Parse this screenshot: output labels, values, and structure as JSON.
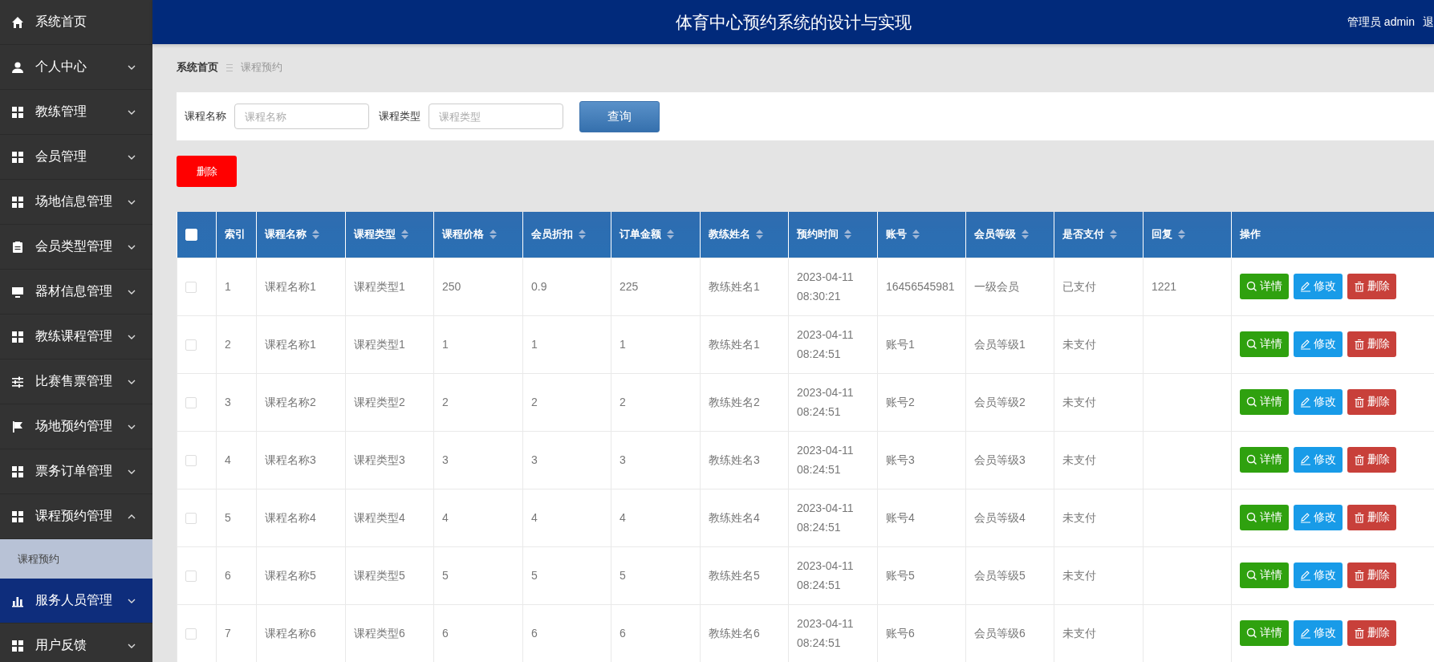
{
  "header": {
    "title": "体育中心预约系统的设计与实现",
    "user": "管理员 admin",
    "logout": "退"
  },
  "sidebar": {
    "items": [
      {
        "label": "系统首页",
        "kind": "link",
        "selected": false
      },
      {
        "label": "个人中心",
        "kind": "menu",
        "expanded": false,
        "selected": false
      },
      {
        "label": "教练管理",
        "kind": "menu",
        "expanded": false,
        "selected": false
      },
      {
        "label": "会员管理",
        "kind": "menu",
        "expanded": false,
        "selected": false
      },
      {
        "label": "场地信息管理",
        "kind": "menu",
        "expanded": false,
        "selected": false
      },
      {
        "label": "会员类型管理",
        "kind": "menu",
        "expanded": false,
        "selected": false
      },
      {
        "label": "器材信息管理",
        "kind": "menu",
        "expanded": false,
        "selected": false
      },
      {
        "label": "教练课程管理",
        "kind": "menu",
        "expanded": false,
        "selected": false
      },
      {
        "label": "比赛售票管理",
        "kind": "menu",
        "expanded": false,
        "selected": false
      },
      {
        "label": "场地预约管理",
        "kind": "menu",
        "expanded": false,
        "selected": false
      },
      {
        "label": "票务订单管理",
        "kind": "menu",
        "expanded": false,
        "selected": false
      },
      {
        "label": "课程预约管理",
        "kind": "menu",
        "expanded": true,
        "selected": false,
        "children": [
          {
            "label": "课程预约"
          }
        ]
      },
      {
        "label": "服务人员管理",
        "kind": "menu",
        "expanded": false,
        "selected": true
      },
      {
        "label": "用户反馈",
        "kind": "menu",
        "expanded": false,
        "selected": false
      }
    ]
  },
  "breadcrumb": [
    {
      "label": "系统首页",
      "current": false
    },
    {
      "label": "课程预约",
      "current": true
    }
  ],
  "search": {
    "fields": [
      {
        "label": "课程名称",
        "placeholder": "课程名称"
      },
      {
        "label": "课程类型",
        "placeholder": "课程类型"
      }
    ],
    "button": "查询"
  },
  "toolbar": {
    "delete_button": "删除"
  },
  "table": {
    "select_all_checked": false,
    "columns": [
      {
        "label": "索引",
        "sortable": false
      },
      {
        "label": "课程名称",
        "sortable": true
      },
      {
        "label": "课程类型",
        "sortable": true
      },
      {
        "label": "课程价格",
        "sortable": true
      },
      {
        "label": "会员折扣",
        "sortable": true
      },
      {
        "label": "订单金额",
        "sortable": true
      },
      {
        "label": "教练姓名",
        "sortable": true
      },
      {
        "label": "预约时间",
        "sortable": true
      },
      {
        "label": "账号",
        "sortable": true
      },
      {
        "label": "会员等级",
        "sortable": true
      },
      {
        "label": "是否支付",
        "sortable": true
      },
      {
        "label": "回复",
        "sortable": true
      },
      {
        "label": "操作",
        "sortable": false
      }
    ],
    "rows": [
      {
        "checked": false,
        "cells": [
          "1",
          "课程名称1",
          "课程类型1",
          "250",
          "0.9",
          "225",
          "教练姓名1",
          "2023-04-11 08:30:21",
          "16456545981",
          "一级会员",
          "已支付",
          "1221"
        ],
        "actions": [
          {
            "kind": "view",
            "label": "详情"
          },
          {
            "kind": "edit",
            "label": "修改"
          },
          {
            "kind": "delete",
            "label": "删除"
          }
        ]
      },
      {
        "checked": false,
        "cells": [
          "2",
          "课程名称1",
          "课程类型1",
          "1",
          "1",
          "1",
          "教练姓名1",
          "2023-04-11 08:24:51",
          "账号1",
          "会员等级1",
          "未支付",
          ""
        ],
        "actions": [
          {
            "kind": "view",
            "label": "详情"
          },
          {
            "kind": "edit",
            "label": "修改"
          },
          {
            "kind": "delete",
            "label": "删除"
          }
        ]
      },
      {
        "checked": false,
        "cells": [
          "3",
          "课程名称2",
          "课程类型2",
          "2",
          "2",
          "2",
          "教练姓名2",
          "2023-04-11 08:24:51",
          "账号2",
          "会员等级2",
          "未支付",
          ""
        ],
        "actions": [
          {
            "kind": "view",
            "label": "详情"
          },
          {
            "kind": "edit",
            "label": "修改"
          },
          {
            "kind": "delete",
            "label": "删除"
          }
        ]
      },
      {
        "checked": false,
        "cells": [
          "4",
          "课程名称3",
          "课程类型3",
          "3",
          "3",
          "3",
          "教练姓名3",
          "2023-04-11 08:24:51",
          "账号3",
          "会员等级3",
          "未支付",
          ""
        ],
        "actions": [
          {
            "kind": "view",
            "label": "详情"
          },
          {
            "kind": "edit",
            "label": "修改"
          },
          {
            "kind": "delete",
            "label": "删除"
          }
        ]
      },
      {
        "checked": false,
        "cells": [
          "5",
          "课程名称4",
          "课程类型4",
          "4",
          "4",
          "4",
          "教练姓名4",
          "2023-04-11 08:24:51",
          "账号4",
          "会员等级4",
          "未支付",
          ""
        ],
        "actions": [
          {
            "kind": "view",
            "label": "详情"
          },
          {
            "kind": "edit",
            "label": "修改"
          },
          {
            "kind": "delete",
            "label": "删除"
          }
        ]
      },
      {
        "checked": false,
        "cells": [
          "6",
          "课程名称5",
          "课程类型5",
          "5",
          "5",
          "5",
          "教练姓名5",
          "2023-04-11 08:24:51",
          "账号5",
          "会员等级5",
          "未支付",
          ""
        ],
        "actions": [
          {
            "kind": "view",
            "label": "详情"
          },
          {
            "kind": "edit",
            "label": "修改"
          },
          {
            "kind": "delete",
            "label": "删除"
          }
        ]
      },
      {
        "checked": false,
        "cells": [
          "7",
          "课程名称6",
          "课程类型6",
          "6",
          "6",
          "6",
          "教练姓名6",
          "2023-04-11 08:24:51",
          "账号6",
          "会员等级6",
          "未支付",
          ""
        ],
        "actions": [
          {
            "kind": "view",
            "label": "详情"
          },
          {
            "kind": "edit",
            "label": "修改"
          },
          {
            "kind": "delete",
            "label": "删除"
          }
        ]
      }
    ]
  }
}
